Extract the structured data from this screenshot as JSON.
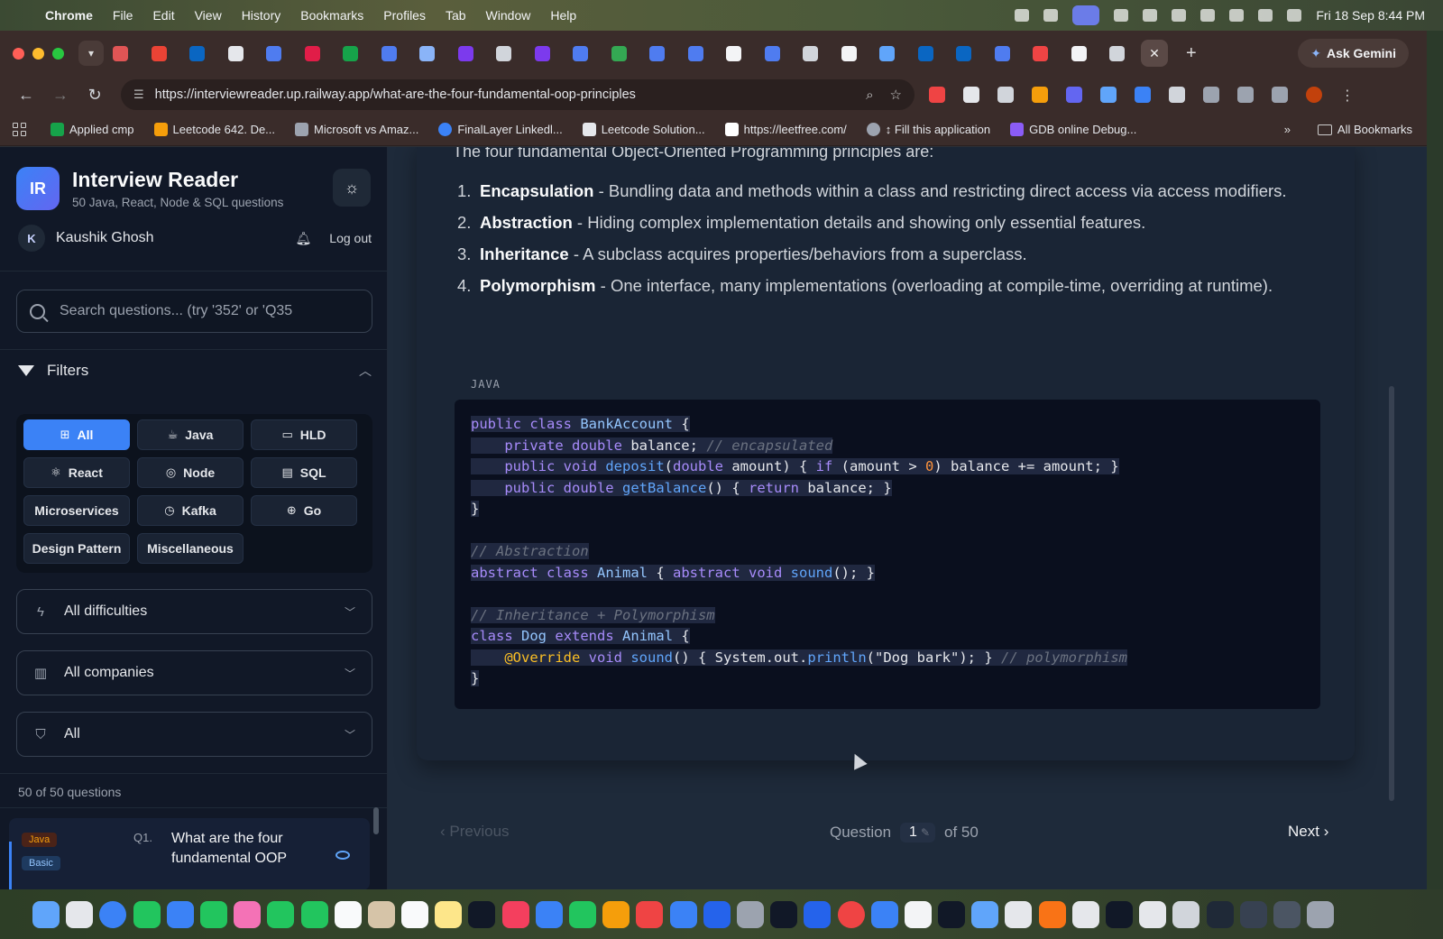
{
  "menubar": {
    "app": "Chrome",
    "items": [
      "File",
      "Edit",
      "View",
      "History",
      "Bookmarks",
      "Profiles",
      "Tab",
      "Window",
      "Help"
    ],
    "clock": "Fri 18 Sep  8:44 PM"
  },
  "browser": {
    "gemini_label": "Ask Gemini",
    "url": "https://interviewreader.up.railway.app/what-are-the-four-fundamental-oop-principles",
    "bookmarks": [
      {
        "label": "Applied cmp",
        "color": "#16a34a"
      },
      {
        "label": "Leetcode 642. De...",
        "color": "#f59e0b"
      },
      {
        "label": "Microsoft vs Amaz...",
        "color": "#9ca3af"
      },
      {
        "label": "FinalLayer Linkedl...",
        "color": "#3b82f6"
      },
      {
        "label": "Leetcode Solution...",
        "color": "#e5e7eb"
      },
      {
        "label": "https://leetfree.com/",
        "color": "#ffffff"
      },
      {
        "label": "↕ Fill this application",
        "color": "#9ca3af"
      },
      {
        "label": "GDB online Debug...",
        "color": "#8b5cf6"
      }
    ],
    "all_bookmarks": "All Bookmarks",
    "more": "»"
  },
  "sidebar": {
    "logo": "IR",
    "title": "Interview Reader",
    "subtitle": "50 Java, React, Node & SQL questions",
    "avatar_letter": "K",
    "user": "Kaushik Ghosh",
    "logout": "Log out",
    "search_placeholder": "Search questions... (try '352' or 'Q35",
    "filters_label": "Filters",
    "chips": [
      "All",
      "Java",
      "HLD",
      "React",
      "Node",
      "SQL",
      "Microservices",
      "Kafka",
      "Go",
      "Design Pattern",
      "Miscellaneous"
    ],
    "difficulty": "All difficulties",
    "companies": "All companies",
    "status": "All",
    "count": "50 of 50 questions",
    "question": {
      "lang": "Java",
      "level": "Basic",
      "num": "Q1.",
      "title": "What are the four fundamental OOP"
    }
  },
  "main": {
    "intro": "The four fundamental Object-Oriented Programming principles are:",
    "principles": [
      {
        "n": "1.",
        "name": "Encapsulation",
        "desc": " - Bundling data and methods within a class and restricting direct access via access modifiers."
      },
      {
        "n": "2.",
        "name": "Abstraction",
        "desc": " - Hiding complex implementation details and showing only essential features."
      },
      {
        "n": "3.",
        "name": "Inheritance",
        "desc": " - A subclass acquires properties/behaviors from a superclass."
      },
      {
        "n": "4.",
        "name": "Polymorphism",
        "desc": " - One interface, many implementations (overloading at compile-time, overriding at runtime)."
      }
    ],
    "code_lang": "JAVA",
    "footer": {
      "previous": "Previous",
      "question_label": "Question",
      "current": "1",
      "of": "of 50",
      "next": "Next"
    }
  },
  "colors": {
    "accent": "#3b82f6",
    "sidebar_bg": "#111827",
    "main_bg": "#1e2a3a",
    "code_bg": "#0a0f1e"
  }
}
